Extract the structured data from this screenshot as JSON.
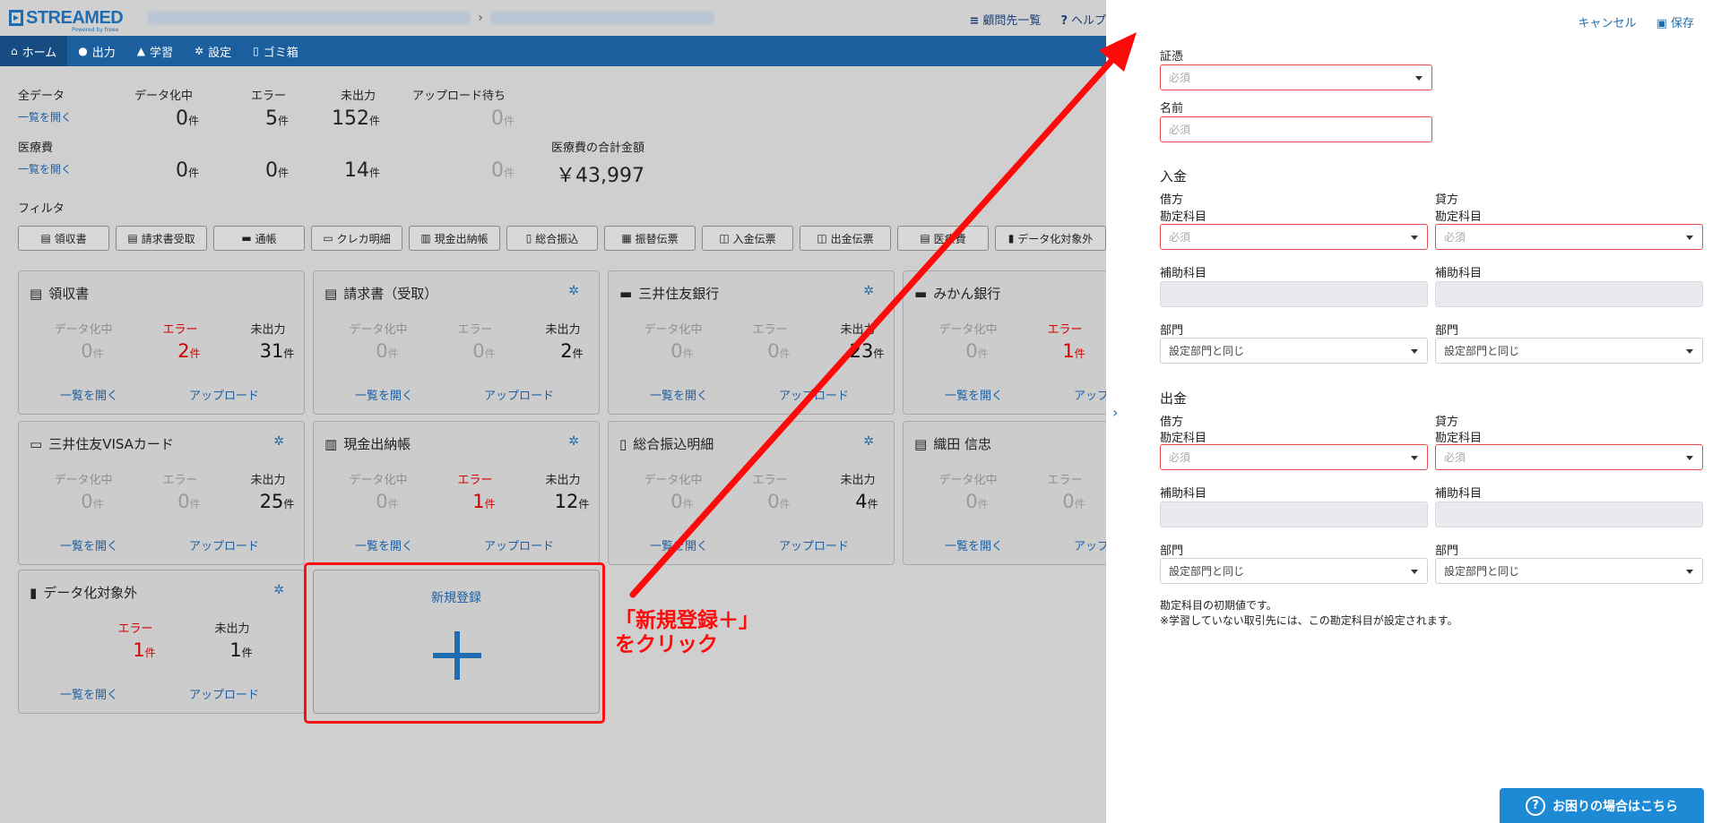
{
  "app": {
    "brand": "STREAMED",
    "brand_sub": "Powered by freee",
    "top_links": [
      {
        "icon": "list-icon",
        "label": "顧問先一覧"
      },
      {
        "icon": "help-icon",
        "label": "ヘルプ"
      }
    ],
    "nav": [
      {
        "icon": "home-icon",
        "label": "ホーム"
      },
      {
        "icon": "users-icon",
        "label": "出力"
      },
      {
        "icon": "graduation-cap-icon",
        "label": "学習"
      },
      {
        "icon": "gear-icon",
        "label": "設定"
      },
      {
        "icon": "trash-icon",
        "label": "ゴミ箱"
      }
    ]
  },
  "summary": {
    "all_data": {
      "label": "全データ",
      "link": "一覧を開く"
    },
    "medical": {
      "label": "医療費",
      "link": "一覧を開く"
    },
    "headers": [
      "データ化中",
      "エラー",
      "未出力",
      "アップロード待ち"
    ],
    "all_values": [
      "0",
      "5",
      "152",
      "0"
    ],
    "medical_values": [
      "0",
      "0",
      "14",
      "0"
    ],
    "unit": "件",
    "medical_total_label": "医療費の合計金額",
    "medical_total": "￥43,997"
  },
  "filters": {
    "label": "フィルタ",
    "items": [
      "領収書",
      "請求書受取",
      "通帳",
      "クレカ明細",
      "現金出納帳",
      "総合振込",
      "振替伝票",
      "入金伝票",
      "出金伝票",
      "医療費",
      "データ化対象外"
    ]
  },
  "cards": {
    "stat_labels": [
      "データ化中",
      "エラー",
      "未出力"
    ],
    "open_link": "一覧を開く",
    "upload_link": "アップロード",
    "unit": "件",
    "items": [
      {
        "title": "領収書",
        "values": [
          "0",
          "2",
          "31"
        ]
      },
      {
        "title": "請求書（受取）",
        "values": [
          "0",
          "0",
          "2"
        ]
      },
      {
        "title": "三井住友銀行",
        "values": [
          "0",
          "0",
          "23"
        ]
      },
      {
        "title": "みかん銀行",
        "values": [
          "0",
          "1",
          ""
        ]
      },
      {
        "title": "三井住友VISAカード",
        "values": [
          "0",
          "0",
          "25"
        ]
      },
      {
        "title": "現金出納帳",
        "values": [
          "0",
          "1",
          "12"
        ]
      },
      {
        "title": "総合振込明細",
        "values": [
          "0",
          "0",
          "4"
        ]
      },
      {
        "title": "織田 信忠",
        "values": [
          "0",
          "0",
          ""
        ]
      },
      {
        "title": "データ化対象外",
        "values": [
          "1",
          "1"
        ]
      }
    ],
    "new_card_label": "新規登録"
  },
  "callout": {
    "line1": "「新規登録＋」",
    "line2": "をクリック"
  },
  "panel": {
    "cancel": "キャンセル",
    "save": "保存",
    "voucher_label": "証憑",
    "name_label": "名前",
    "required": "必須",
    "deposit_section": "入金",
    "withdraw_section": "出金",
    "debit": "借方",
    "credit": "貸方",
    "account": "勘定科目",
    "sub_account": "補助科目",
    "department": "部門",
    "dept_value": "設定部門と同じ",
    "note_line1": "勘定科目の初期値です。",
    "note_line2": "※学習していない取引先には、この勘定科目が設定されます。"
  },
  "help_button": "お困りの場合はこちら"
}
